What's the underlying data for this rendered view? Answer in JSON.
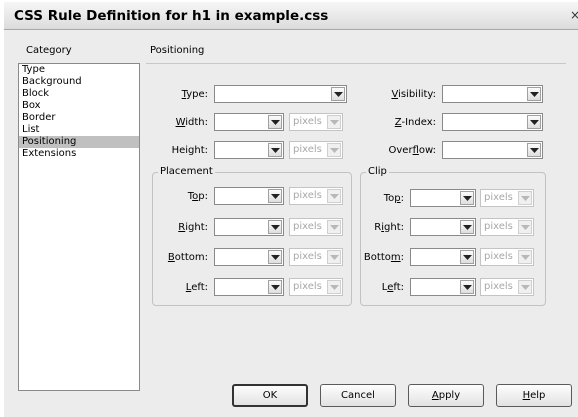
{
  "window": {
    "title": "CSS Rule Definition for h1 in example.css",
    "close_glyph": "×"
  },
  "category": {
    "label": "Category",
    "items": [
      "Type",
      "Background",
      "Block",
      "Box",
      "Border",
      "List",
      "Positioning",
      "Extensions"
    ],
    "selected": "Positioning"
  },
  "panel": {
    "heading": "Positioning",
    "type": {
      "pre": "",
      "key": "T",
      "post": "ype:",
      "value": ""
    },
    "width": {
      "pre": "",
      "key": "W",
      "post": "idth:",
      "value": "",
      "unit": "pixels"
    },
    "height": {
      "pre": "Height:",
      "key": "",
      "post": "",
      "value": "",
      "unit": "pixels"
    },
    "visibility": {
      "pre": "",
      "key": "V",
      "post": "isibility:",
      "value": ""
    },
    "zindex": {
      "pre": "",
      "key": "Z",
      "post": "-Index:",
      "value": ""
    },
    "overflow": {
      "pre": "Over",
      "key": "f",
      "post": "low:",
      "value": ""
    }
  },
  "placement": {
    "legend": "Placement",
    "top": {
      "pre": "T",
      "key": "o",
      "post": "p:",
      "value": "",
      "unit": "pixels"
    },
    "right": {
      "pre": "",
      "key": "R",
      "post": "ight:",
      "value": "",
      "unit": "pixels"
    },
    "bottom": {
      "pre": "",
      "key": "B",
      "post": "ottom:",
      "value": "",
      "unit": "pixels"
    },
    "left": {
      "pre": "",
      "key": "L",
      "post": "eft:",
      "value": "",
      "unit": "pixels"
    }
  },
  "clip": {
    "legend": "Clip",
    "top": {
      "pre": "To",
      "key": "p",
      "post": ":",
      "value": "",
      "unit": "pixels"
    },
    "right": {
      "pre": "R",
      "key": "i",
      "post": "ght:",
      "value": "",
      "unit": "pixels"
    },
    "bottom": {
      "pre": "Botto",
      "key": "m",
      "post": ":",
      "value": "",
      "unit": "pixels"
    },
    "left": {
      "pre": "L",
      "key": "e",
      "post": "ft:",
      "value": "",
      "unit": "pixels"
    }
  },
  "buttons": {
    "ok": "OK",
    "cancel": "Cancel",
    "apply": {
      "pre": "",
      "key": "A",
      "post": "pply"
    },
    "help": {
      "pre": "",
      "key": "H",
      "post": "elp"
    }
  }
}
